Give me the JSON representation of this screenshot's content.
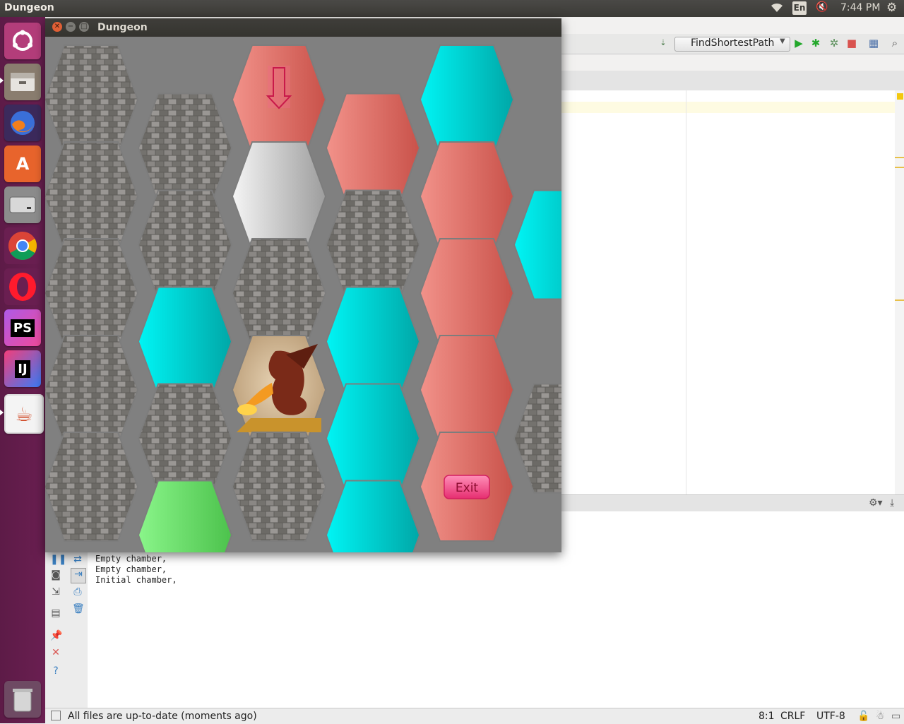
{
  "top_panel": {
    "app_title": "Dungeon",
    "language": "En",
    "clock": "7:44 PM"
  },
  "launcher": {
    "items": [
      {
        "name": "ubuntu-dash",
        "label": ""
      },
      {
        "name": "files",
        "label": ""
      },
      {
        "name": "firefox",
        "label": ""
      },
      {
        "name": "software-center",
        "label": "A"
      },
      {
        "name": "disk",
        "label": ""
      },
      {
        "name": "chrome",
        "label": ""
      },
      {
        "name": "opera",
        "label": ""
      },
      {
        "name": "phpstorm",
        "label": "PS"
      },
      {
        "name": "intellij",
        "label": "IJ"
      },
      {
        "name": "java",
        "label": "☕"
      }
    ]
  },
  "ide": {
    "run_config": "FindShortestPath",
    "console_lines": [
      "Empty chamber,",
      "Empty chamber,",
      "Initial chamber,"
    ],
    "status_message": "All files are up-to-date (moments ago)",
    "cursor_pos": "8:1",
    "line_sep": "CRLF",
    "encoding": "UTF-8"
  },
  "dungeon": {
    "window_title": "Dungeon",
    "exit_label": "Exit",
    "colors": {
      "wall": "#6e6c69",
      "pink": "#e57a72",
      "cyan": "#00d6d6",
      "gray": "#c8c8c8",
      "green": "#6fdc6f",
      "background": "#808080"
    },
    "hexes": [
      {
        "col": 0,
        "row": 0,
        "type": "wall"
      },
      {
        "col": 1,
        "row": 0,
        "type": "wall"
      },
      {
        "col": 2,
        "row": 0,
        "type": "pink",
        "icon": "down-arrow"
      },
      {
        "col": 3,
        "row": 0,
        "type": "pink"
      },
      {
        "col": 4,
        "row": 0,
        "type": "cyan"
      },
      {
        "col": 0,
        "row": 1,
        "type": "wall"
      },
      {
        "col": 1,
        "row": 1,
        "type": "wall"
      },
      {
        "col": 2,
        "row": 1,
        "type": "gray"
      },
      {
        "col": 3,
        "row": 1,
        "type": "wall"
      },
      {
        "col": 4,
        "row": 1,
        "type": "pink"
      },
      {
        "col": 5,
        "row": 1,
        "type": "cyan"
      },
      {
        "col": 0,
        "row": 2,
        "type": "wall"
      },
      {
        "col": 1,
        "row": 2,
        "type": "cyan"
      },
      {
        "col": 2,
        "row": 2,
        "type": "wall"
      },
      {
        "col": 3,
        "row": 2,
        "type": "cyan"
      },
      {
        "col": 4,
        "row": 2,
        "type": "pink"
      },
      {
        "col": 0,
        "row": 3,
        "type": "wall"
      },
      {
        "col": 1,
        "row": 3,
        "type": "wall"
      },
      {
        "col": 2,
        "row": 3,
        "type": "dragon"
      },
      {
        "col": 3,
        "row": 3,
        "type": "cyan"
      },
      {
        "col": 4,
        "row": 3,
        "type": "pink"
      },
      {
        "col": 5,
        "row": 3,
        "type": "wall"
      },
      {
        "col": 0,
        "row": 4,
        "type": "wall"
      },
      {
        "col": 1,
        "row": 4,
        "type": "green"
      },
      {
        "col": 2,
        "row": 4,
        "type": "wall"
      },
      {
        "col": 3,
        "row": 4,
        "type": "cyan"
      },
      {
        "col": 4,
        "row": 4,
        "type": "pink",
        "icon": "exit"
      }
    ]
  }
}
